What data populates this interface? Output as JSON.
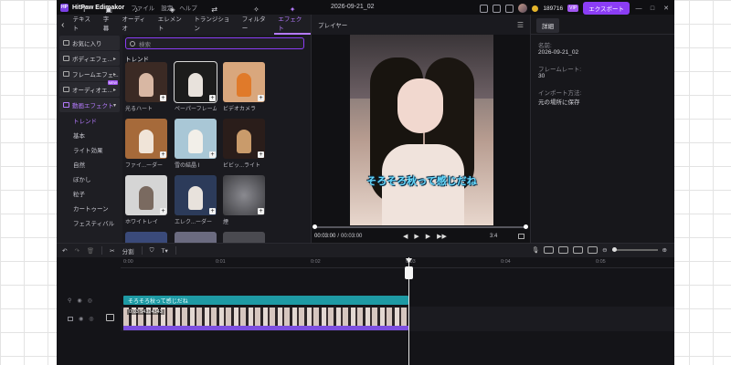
{
  "titlebar": {
    "logo": "HP",
    "app_name": "HitPaw Edimakor",
    "menus": [
      "ファイル",
      "設定",
      "ヘルプ"
    ],
    "document_title": "2026-09-21_02",
    "credits": "189716",
    "vip": "VIP",
    "export_label": "エクスポート",
    "window_controls": [
      "—",
      "□",
      "✕"
    ]
  },
  "toolbar": {
    "tabs": [
      {
        "icon": "text-icon",
        "glyph": "T",
        "label": "テキスト"
      },
      {
        "icon": "subtitle-icon",
        "glyph": "▣",
        "label": "字幕"
      },
      {
        "icon": "audio-icon",
        "glyph": "♪",
        "label": "オーディオ"
      },
      {
        "icon": "element-icon",
        "glyph": "◈",
        "label": "エレメント"
      },
      {
        "icon": "transition-icon",
        "glyph": "⇄",
        "label": "トランジション"
      },
      {
        "icon": "filter-icon",
        "glyph": "✧",
        "label": "フィルター"
      },
      {
        "icon": "effect-icon",
        "glyph": "✦",
        "label": "エフェクト",
        "active": true
      }
    ]
  },
  "categories": {
    "items": [
      {
        "label": "お気に入り"
      },
      {
        "label": "ボディエフェ...",
        "arrow": "▸"
      },
      {
        "label": "フレームエフェ...",
        "arrow": "▸"
      },
      {
        "label": "オーディオエ...",
        "arrow": "▸",
        "badge": "NEW"
      },
      {
        "label": "動画エフェクト",
        "arrow": "▾",
        "active": true
      }
    ],
    "subitems": [
      "トレンド",
      "基本",
      "ライト効果",
      "自然",
      "ぼかし",
      "粒子",
      "カートゥーン",
      "フェスティバル"
    ]
  },
  "effects": {
    "search_placeholder": "検索",
    "section_title": "トレンド",
    "tiles": [
      {
        "label": "光るハート",
        "bg": "#3b2a24"
      },
      {
        "label": "ペーパーフレーム",
        "bg": "#1c1c1c",
        "selected": true
      },
      {
        "label": "ビデオカメラ",
        "bg": "#d9a77d"
      },
      {
        "label": "ファイ...ーダー",
        "bg": "#a66a3a"
      },
      {
        "label": "雪の結晶 I",
        "bg": "#a9c7d6"
      },
      {
        "label": "ビビッ...ライト",
        "bg": "#2a1d1a"
      },
      {
        "label": "ホワイトレイ",
        "bg": "#d5d5d5"
      },
      {
        "label": "エレク...ーダー",
        "bg": "#2c3b5a"
      },
      {
        "label": "煙",
        "bg": "#3c3c40"
      }
    ]
  },
  "player": {
    "title": "プレイヤー",
    "caption": "そろそろ秋って感じだね",
    "current_time": "00:03:00",
    "total_time": "00:03:00",
    "aspect_ratio": "3:4",
    "progress": 1.0
  },
  "details": {
    "tab": "詳細",
    "fields": [
      {
        "label": "名前:",
        "value": "2026-09-21_02"
      },
      {
        "label": "フレームレート:",
        "value": "30"
      },
      {
        "label": "インポート方法:",
        "value": "元の場所に保存"
      }
    ]
  },
  "timeline_tools": {
    "split_label": "分割"
  },
  "timeline": {
    "ticks": [
      "0:00",
      "0:01",
      "0:02",
      "0:03",
      "0:04",
      "0:05"
    ],
    "text_clip": "そろそろ秋って感じだね",
    "video_clip_name": "0:03 54324343"
  }
}
